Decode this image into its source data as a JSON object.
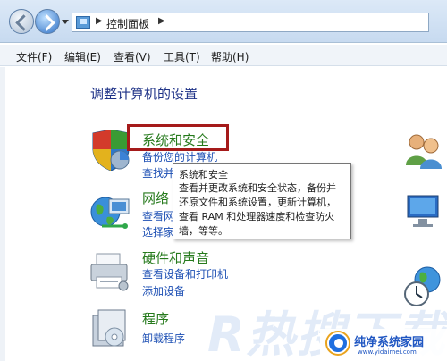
{
  "address_bar": {
    "breadcrumb": "控制面板"
  },
  "menu": [
    "文件(F)",
    "编辑(E)",
    "查看(V)",
    "工具(T)",
    "帮助(H)"
  ],
  "page_title": "调整计算机的设置",
  "categories": [
    {
      "heading": "系统和安全",
      "links": [
        "备份您的计算机",
        "查找并"
      ]
    },
    {
      "heading": "网络",
      "links": [
        "查看网",
        "选择家"
      ]
    },
    {
      "heading": "硬件和声音",
      "links": [
        "查看设备和打印机",
        "添加设备"
      ]
    },
    {
      "heading": "程序",
      "links": [
        "卸载程序"
      ]
    }
  ],
  "tooltip": {
    "title": "系统和安全",
    "lines": [
      "查看并更改系统和安全状态，备份并",
      "还原文件和系统设置，更新计算机，",
      "查看 RAM 和处理器速度和检查防火",
      "墙，等等。"
    ]
  },
  "watermark": {
    "big": "R热搜下载",
    "name": "纯净系统家园",
    "url": "www.yidaimei.com"
  },
  "colors": {
    "heading_green": "#267a1c",
    "link_blue": "#1e50b4",
    "title_blue": "#1e3287",
    "highlight_red": "#a51a1a"
  }
}
